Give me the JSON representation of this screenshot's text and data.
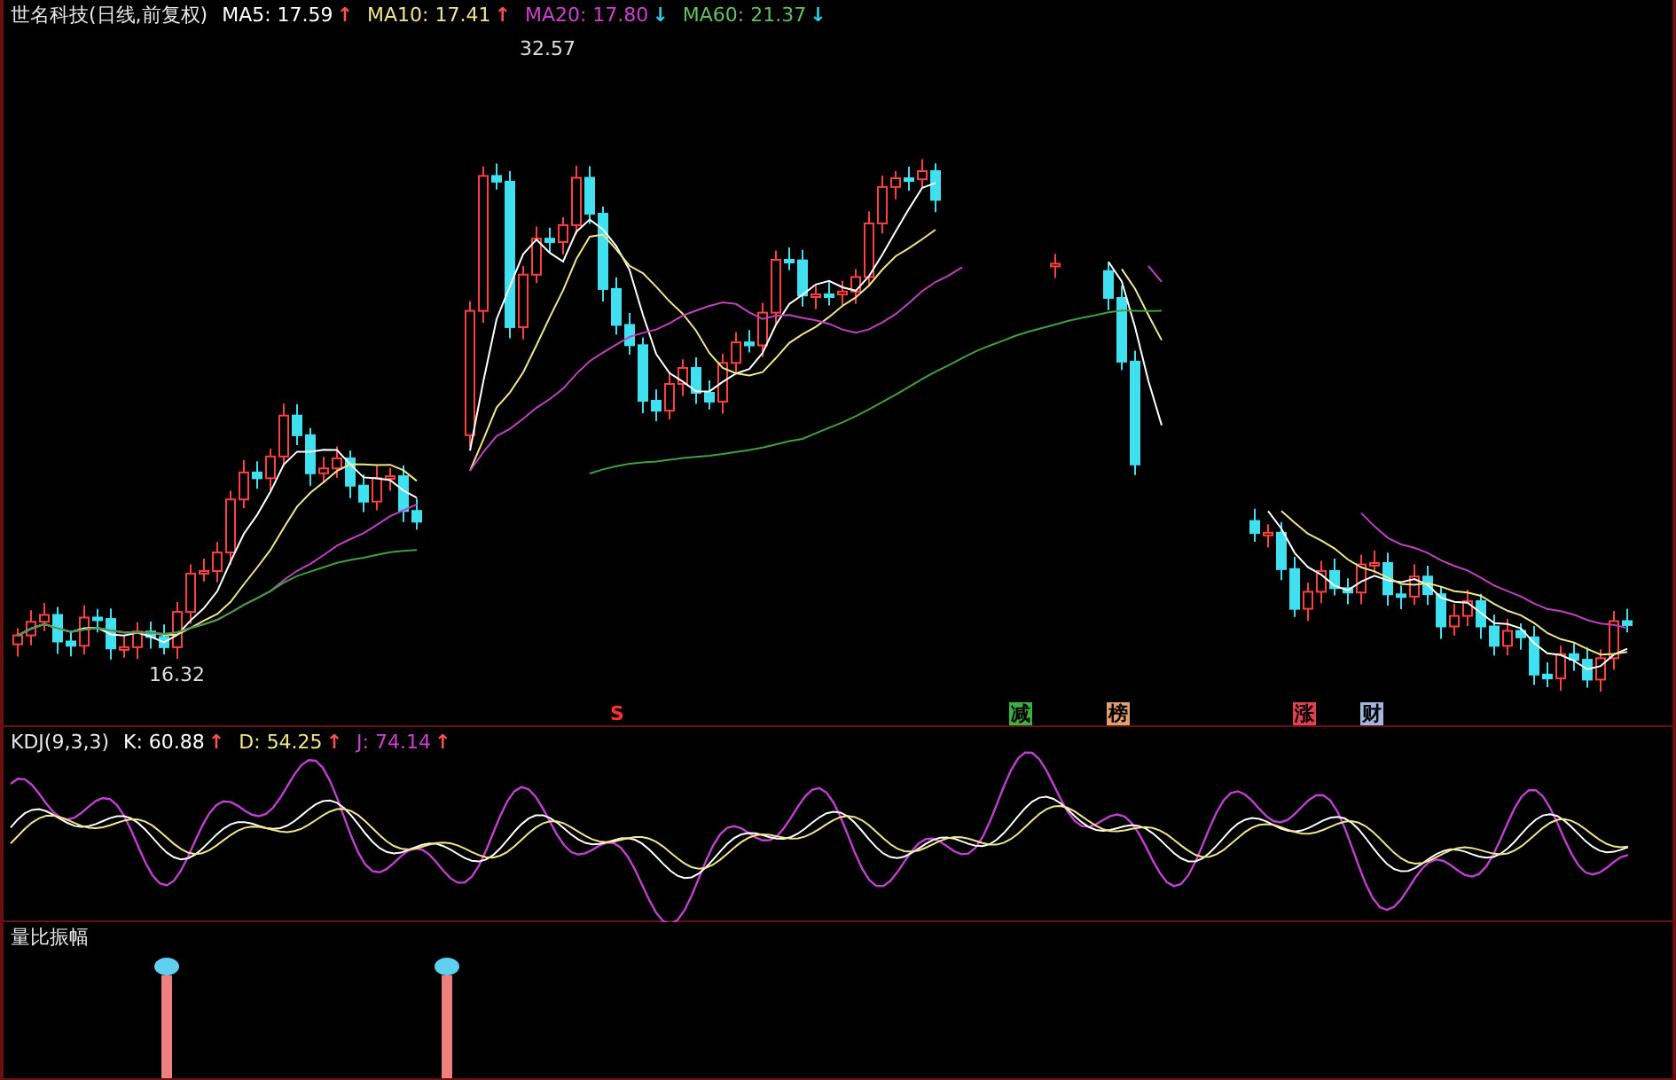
{
  "main_panel": {
    "title": "世名科技(日线,前复权)",
    "indicators": [
      {
        "label": "MA5: 17.59",
        "color": "#ffffff",
        "trend": {
          "text": "↑",
          "color": "#ff5050"
        }
      },
      {
        "label": "MA10: 17.41",
        "color": "#f0e68c",
        "trend": {
          "text": "↑",
          "color": "#ff5050"
        }
      },
      {
        "label": "MA20: 17.80",
        "color": "#d040d0",
        "trend": {
          "text": "↓",
          "color": "#30d0e0"
        }
      },
      {
        "label": "MA60: 21.37",
        "color": "#60c060",
        "trend": {
          "text": "↓",
          "color": "#30d0e0"
        }
      }
    ],
    "annotations": [
      {
        "text": "32.57",
        "kind": "high"
      },
      {
        "text": "16.32",
        "kind": "low"
      }
    ],
    "signals": [
      {
        "text": "S",
        "kind": "plain",
        "color": "#ff3030"
      },
      {
        "text": "减",
        "kind": "tag",
        "color": "#3cb043"
      },
      {
        "text": "榜",
        "kind": "tag",
        "color": "#e0a070"
      },
      {
        "text": "涨",
        "kind": "tag",
        "color": "#e04050"
      },
      {
        "text": "财",
        "kind": "tag",
        "color": "#a0b8e0"
      }
    ]
  },
  "kdj_panel": {
    "title": "KDJ(9,3,3)",
    "indicators": [
      {
        "label": "K: 60.88",
        "color": "#ffffff",
        "trend": {
          "text": "↑",
          "color": "#ff5050"
        }
      },
      {
        "label": "D: 54.25",
        "color": "#f0e68c",
        "trend": {
          "text": "↑",
          "color": "#ff5050"
        }
      },
      {
        "label": "J: 74.14",
        "color": "#d040d0",
        "trend": {
          "text": "↑",
          "color": "#ff5050"
        }
      }
    ]
  },
  "ratio_panel": {
    "title": "量比振幅"
  }
}
